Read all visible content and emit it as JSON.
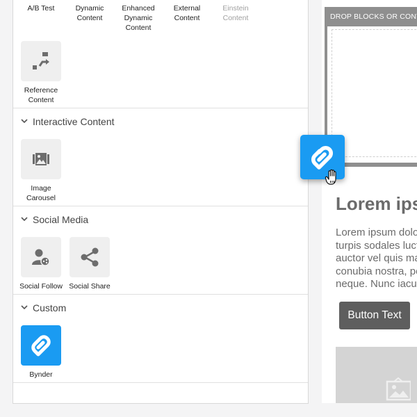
{
  "sections": {
    "top_blocks": [
      {
        "label": "A/B Test",
        "icon": "ab-test-icon",
        "disabled": false
      },
      {
        "label": "Dynamic Content",
        "icon": "dynamic-content-icon",
        "disabled": false
      },
      {
        "label": "Enhanced Dynamic Content",
        "icon": "enhanced-dynamic-content-icon",
        "disabled": false
      },
      {
        "label": "External Content",
        "icon": "external-content-icon",
        "disabled": false
      },
      {
        "label": "Einstein Content",
        "icon": "einstein-content-icon",
        "disabled": true
      }
    ],
    "reference": {
      "label": "Reference Content",
      "icon": "reference-content-icon"
    },
    "interactive": {
      "title": "Interactive Content",
      "blocks": [
        {
          "label": "Image Carousel",
          "icon": "image-carousel-icon"
        }
      ]
    },
    "social": {
      "title": "Social Media",
      "blocks": [
        {
          "label": "Social Follow",
          "icon": "social-follow-icon"
        },
        {
          "label": "Social Share",
          "icon": "share-icon"
        }
      ]
    },
    "custom": {
      "title": "Custom",
      "blocks": [
        {
          "label": "Bynder",
          "icon": "bynder-logo-icon"
        }
      ]
    }
  },
  "canvas": {
    "drop_label": "DROP BLOCKS OR CONTENT HERE",
    "heading": "Lorem ipsum",
    "body_lines": [
      "Lorem ipsum dolor sit amet,",
      "turpis sodales luctus",
      "auctor vel quis mauris per",
      "conubia nostra, per inceptos",
      "neque. Nunc iaculis"
    ],
    "button_label": "Button Text"
  },
  "drag": {
    "item": "Bynder",
    "icon": "bynder-logo-icon"
  },
  "colors": {
    "accent": "#1a9bf2",
    "tile": "#efefef",
    "icon_gray": "#6d6d6d"
  }
}
